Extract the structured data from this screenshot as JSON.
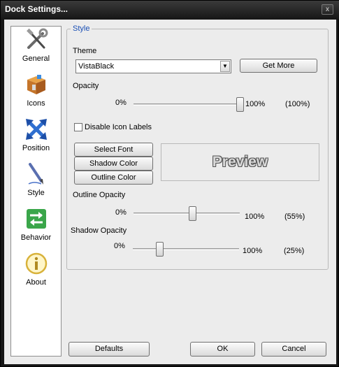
{
  "window": {
    "title": "Dock Settings...",
    "close_glyph": "x"
  },
  "sidebar": {
    "items": [
      {
        "label": "General",
        "icon": "tools-icon"
      },
      {
        "label": "Icons",
        "icon": "box-icon"
      },
      {
        "label": "Position",
        "icon": "arrows-icon"
      },
      {
        "label": "Style",
        "icon": "pen-icon"
      },
      {
        "label": "Behavior",
        "icon": "behavior-arrows-icon"
      },
      {
        "label": "About",
        "icon": "info-icon"
      }
    ]
  },
  "style_group": {
    "title": "Style",
    "theme": {
      "label": "Theme",
      "value": "VistaBlack",
      "get_more_label": "Get More"
    },
    "opacity": {
      "label": "Opacity",
      "min_label": "0%",
      "max_label": "100%",
      "value_label": "(100%)",
      "value": 100
    },
    "disable_icon_labels": {
      "label": "Disable Icon Labels",
      "checked": false
    },
    "font_buttons": {
      "select_font": "Select Font",
      "shadow_color": "Shadow Color",
      "outline_color": "Outline Color"
    },
    "preview": {
      "text": "Preview"
    },
    "outline_opacity": {
      "label": "Outline Opacity",
      "min_label": "0%",
      "max_label": "100%",
      "value_label": "(55%)",
      "value": 55
    },
    "shadow_opacity": {
      "label": "Shadow Opacity",
      "min_label": "0%",
      "max_label": "100%",
      "value_label": "(25%)",
      "value": 25
    }
  },
  "footer": {
    "defaults_label": "Defaults",
    "ok_label": "OK",
    "cancel_label": "Cancel"
  },
  "colors": {
    "titlebar": "#161616",
    "group_title": "#1a4fb5",
    "dialog_bg": "#ececec"
  }
}
